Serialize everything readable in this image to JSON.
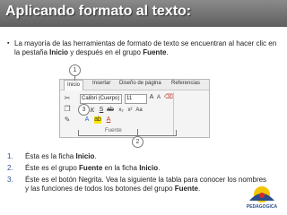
{
  "header": {
    "title": "Aplicando formato al texto:"
  },
  "intro": {
    "bullet": "▪",
    "part1": "La mayoría de las herramientas de formato de texto se encuentran al hacer clic en la pestaña ",
    "bold1": "Inicio",
    "part2": " y después en el grupo ",
    "bold2": "Fuente",
    "part3": "."
  },
  "ribbon": {
    "tabs": [
      "Inicio",
      "Insertar",
      "Diseño de página",
      "Referencias"
    ],
    "font_name": "Calibri (Cuerpo)",
    "font_size": "11",
    "group_label": "Fuente",
    "callouts": [
      "1",
      "2",
      "3"
    ]
  },
  "steps": [
    {
      "num": "1.",
      "pre": "Ésta es la ficha ",
      "bold": "Inicio",
      "post": "."
    },
    {
      "num": "2.",
      "pre": "Éste es el grupo ",
      "bold": "Fuente",
      "mid": " en la ficha ",
      "bold2": "Inicio",
      "post": "."
    },
    {
      "num": "3.",
      "pre": "Éste es el botón Negrita. Vea la siguiente la tabla para conocer los nombres y las funciones de todos los botones del grupo ",
      "bold": "Fuente",
      "post": "."
    }
  ],
  "logo": {
    "text": "PEDAGOGICA"
  }
}
